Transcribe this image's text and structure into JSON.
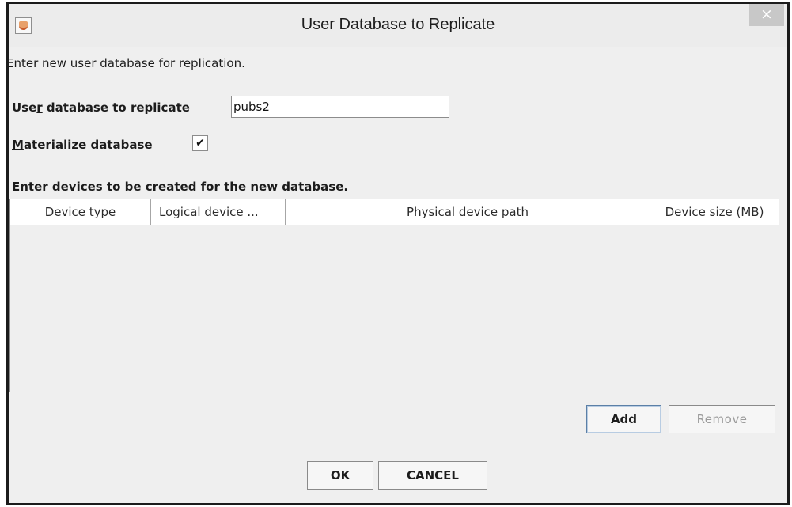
{
  "window": {
    "title": "User Database to Replicate",
    "close_glyph": "×",
    "app_icon": "java-cup-icon"
  },
  "form": {
    "description": "Enter new user database for replication.",
    "db_label_pre": "Use",
    "db_label_mnemonic": "r",
    "db_label_post": " database to replicate",
    "db_value": "pubs2",
    "mat_label_mnemonic": "M",
    "mat_label_post": "aterialize database",
    "mat_checked_glyph": "✔",
    "devices_label": "Enter devices to be created for the new database."
  },
  "table": {
    "columns": [
      "Device type",
      "Logical device ...",
      "Physical device path",
      "Device size (MB)"
    ],
    "rows": []
  },
  "buttons": {
    "add": "Add",
    "remove": "Remove",
    "ok": "OK",
    "cancel": "CANCEL"
  }
}
